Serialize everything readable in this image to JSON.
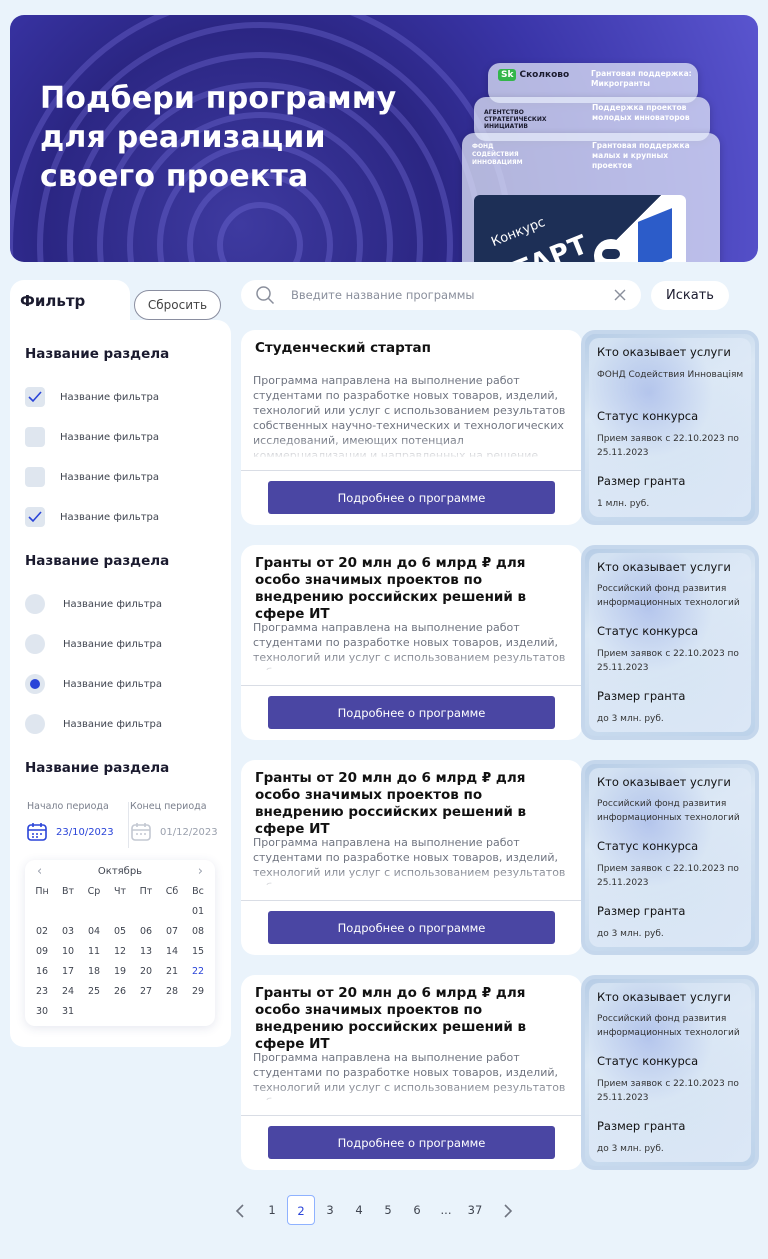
{
  "banner": {
    "title": "Подбери программу для реализации своего проекта",
    "cards": [
      {
        "logo": "Сколково",
        "logo_badge": "Sk",
        "caption": "Грантовая поддержка: Микрогранты"
      },
      {
        "logo": "АГЕНТСТВО СТРАТЕГИЧЕСКИХ ИНИЦИАТИВ",
        "caption": "Поддержка проектов молодых инноваторов"
      },
      {
        "logo": "ФОНД СОДЕЙСТВИЯ ИННОВАЦИЯМ",
        "caption": "Грантовая поддержка малых и крупных проектов"
      }
    ],
    "contest_small": "Конкурс",
    "contest_big": "СТАРТ"
  },
  "filter": {
    "title": "Фильтр",
    "reset_label": "Сбросить",
    "section1": {
      "title": "Название раздела",
      "items": [
        {
          "label": "Название фильтра",
          "checked": true
        },
        {
          "label": "Название фильтра",
          "checked": false
        },
        {
          "label": "Название фильтра",
          "checked": false
        },
        {
          "label": "Название фильтра",
          "checked": true
        }
      ]
    },
    "section2": {
      "title": "Название раздела",
      "items": [
        {
          "label": "Название фильтра",
          "selected": false
        },
        {
          "label": "Название фильтра",
          "selected": false
        },
        {
          "label": "Название фильтра",
          "selected": true
        },
        {
          "label": "Название фильтра",
          "selected": false
        }
      ]
    },
    "section3": {
      "title": "Название раздела",
      "start_label": "Начало периода",
      "start_value": "23/10/2023",
      "end_label": "Конец периода",
      "end_value": "01/12/2023"
    },
    "calendar": {
      "month": "Октябрь",
      "weekdays": [
        "Пн",
        "Вт",
        "Ср",
        "Чт",
        "Пт",
        "Сб",
        "Вс"
      ],
      "leading_blanks": 6,
      "days": [
        "01",
        "02",
        "03",
        "04",
        "05",
        "06",
        "07",
        "08",
        "09",
        "10",
        "11",
        "12",
        "13",
        "14",
        "15",
        "16",
        "17",
        "18",
        "19",
        "20",
        "21",
        "22",
        "23",
        "24",
        "25",
        "26",
        "27",
        "28",
        "29",
        "30",
        "31"
      ],
      "highlighted_day": "22"
    }
  },
  "search": {
    "placeholder": "Введите название программы",
    "value": "",
    "button_label": "Искать"
  },
  "programs": [
    {
      "title": "Студенческий стартап",
      "description": "Программа направлена на выполнение работ студентами по разработке новых товаров, изделий, технологий или услуг с использованием результатов собственных научно-технических и технологических исследований, имеющих потенциал коммерциализации и направленных на решение",
      "button": "Подробнее о программе",
      "provider_label": "Кто оказывает услуги",
      "provider": "ФОНД Содействия Инноваціям",
      "status_label": "Статус конкурса",
      "status": "Прием заявок с 22.10.2023 по 25.11.2023",
      "size_label": "Размер гранта",
      "size": "1 млн. руб."
    },
    {
      "title": "Гранты от 20 млн до 6 млрд ₽ для особо значимых проектов по внедрению российских решений в сфере ИТ",
      "description": "Программа направлена на выполнение работ студентами по разработке новых товаров, изделий, технологий или услуг с использованием результатов собственных",
      "button": "Подробнее о программе",
      "provider_label": "Кто оказывает услуги",
      "provider": "Российский фонд развития информационных технологий",
      "status_label": "Статус конкурса",
      "status": "Прием заявок с 22.10.2023 по 25.11.2023",
      "size_label": "Размер гранта",
      "size": "до 3 млн. руб."
    },
    {
      "title": "Гранты от 20 млн до 6 млрд ₽ для особо значимых проектов по внедрению российских решений в сфере ИТ",
      "description": "Программа направлена на выполнение работ студентами по разработке новых товаров, изделий, технологий или услуг с использованием результатов собственных",
      "button": "Подробнее о программе",
      "provider_label": "Кто оказывает услуги",
      "provider": "Российский фонд развития информационных технологий",
      "status_label": "Статус конкурса",
      "status": "Прием заявок с 22.10.2023 по 25.11.2023",
      "size_label": "Размер гранта",
      "size": "до 3 млн. руб."
    },
    {
      "title": "Гранты от 20 млн до 6 млрд ₽ для особо значимых проектов по внедрению российских решений в сфере ИТ",
      "description": "Программа направлена на выполнение работ студентами по разработке новых товаров, изделий, технологий или услуг с использованием результатов собственных",
      "button": "Подробнее о программе",
      "provider_label": "Кто оказывает услуги",
      "provider": "Российский фонд развития информационных технологий",
      "status_label": "Статус конкурса",
      "status": "Прием заявок с 22.10.2023 по 25.11.2023",
      "size_label": "Размер гранта",
      "size": "до 3 млн. руб."
    }
  ],
  "pagination": {
    "pages": [
      "1",
      "2",
      "3",
      "4",
      "5",
      "6",
      "...",
      "37"
    ],
    "current": "2",
    "prev_icon": "chevron-left-icon",
    "next_icon": "chevron-right-icon"
  },
  "colors": {
    "accent": "#4a46a3",
    "page_bg": "#eaf3fb",
    "active_blue": "#2a44d8"
  }
}
